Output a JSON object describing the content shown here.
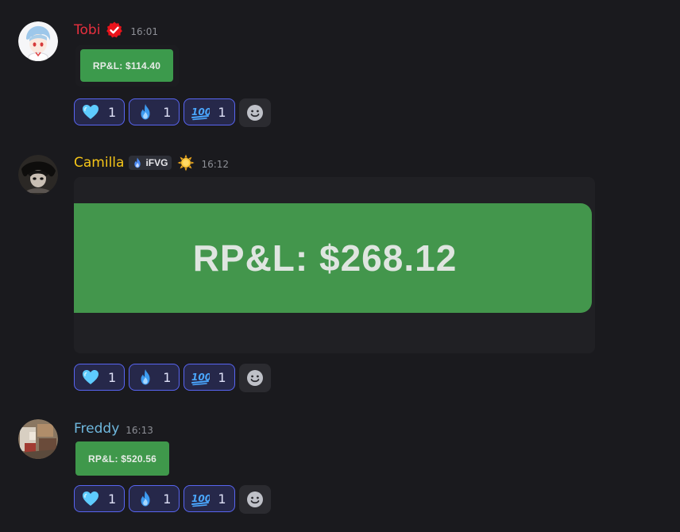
{
  "colors": {
    "background": "#1a1a1e",
    "pnl_green": "#3c9a4c",
    "reaction_bg": "#26284a",
    "reaction_border": "#5865f2"
  },
  "messages": [
    {
      "username": "Tobi",
      "username_color": "#e8303f",
      "badge": "verified-icon",
      "timestamp": "16:01",
      "attachment_text": "RP&L: $114.40",
      "reactions": [
        {
          "icon": "blue-heart-icon",
          "count": "1"
        },
        {
          "icon": "fire-icon",
          "count": "1"
        },
        {
          "icon": "hundred-points-icon",
          "count": "1"
        }
      ]
    },
    {
      "username": "Camilla",
      "username_color": "#f5c518",
      "role_tag": "iFVG",
      "badge": "sun-icon",
      "timestamp": "16:12",
      "attachment_text": "RP&L: $268.12",
      "reactions": [
        {
          "icon": "blue-heart-icon",
          "count": "1"
        },
        {
          "icon": "fire-icon",
          "count": "1"
        },
        {
          "icon": "hundred-points-icon",
          "count": "1"
        }
      ]
    },
    {
      "username": "Freddy",
      "username_color": "#6fb8de",
      "timestamp": "16:13",
      "attachment_text": "RP&L: $520.56",
      "reactions": [
        {
          "icon": "blue-heart-icon",
          "count": "1"
        },
        {
          "icon": "fire-icon",
          "count": "1"
        },
        {
          "icon": "hundred-points-icon",
          "count": "1"
        }
      ]
    }
  ]
}
